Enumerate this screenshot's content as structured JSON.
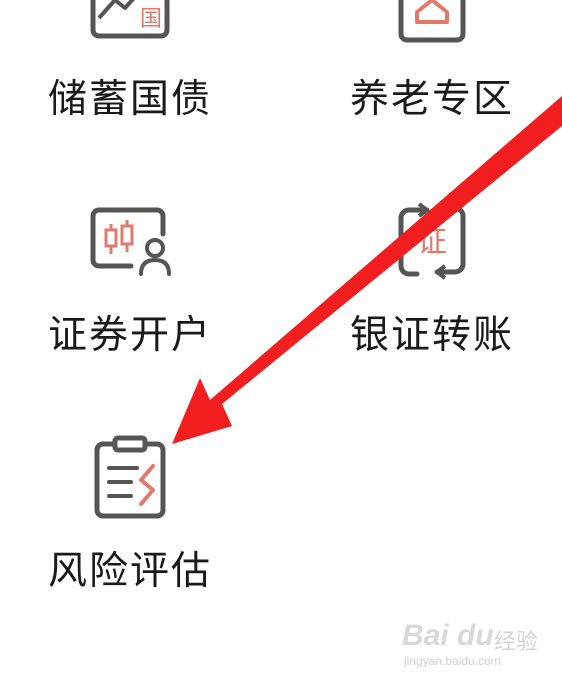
{
  "menu": {
    "items": [
      {
        "label": "储蓄国债",
        "icon": "chart-growth-icon"
      },
      {
        "label": "养老专区",
        "icon": "pension-house-icon"
      },
      {
        "label": "证券开户",
        "icon": "candlestick-user-icon"
      },
      {
        "label": "银证转账",
        "icon": "transfer-cycle-icon"
      },
      {
        "label": "风险评估",
        "icon": "clipboard-risk-icon"
      }
    ]
  },
  "icon_glyphs": {
    "savings": "国",
    "transfer": "证"
  },
  "watermark": {
    "brand": "Bai du",
    "cn": "经验",
    "url": "jingyan.baidu.com"
  },
  "colors": {
    "icon_gray": "#555555",
    "icon_accent": "#e07a6e",
    "arrow_red": "#f01e1e",
    "label": "#1a1a1a"
  }
}
